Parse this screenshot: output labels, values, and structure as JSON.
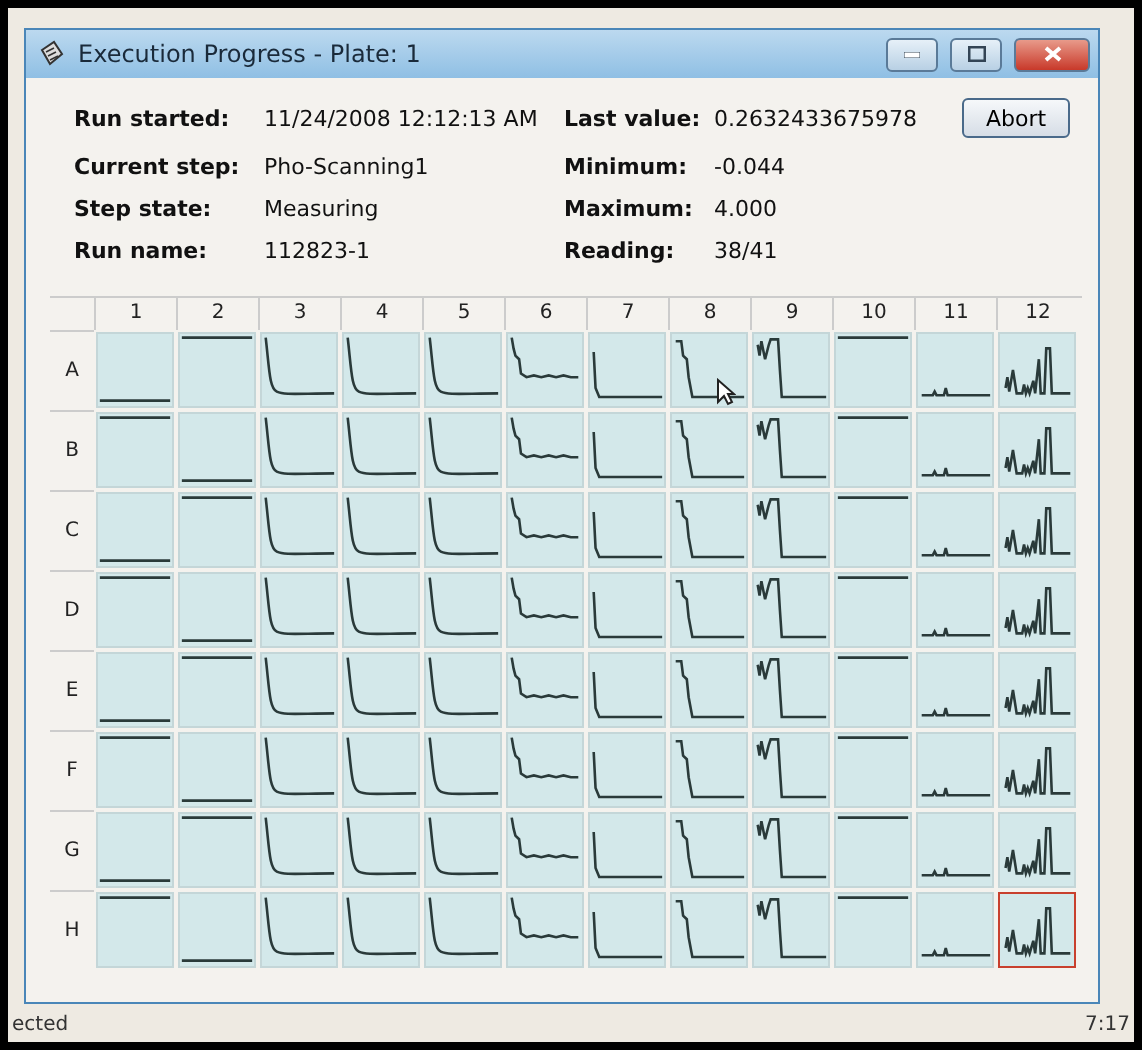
{
  "window": {
    "title": "Execution Progress - Plate: 1"
  },
  "info_left": [
    {
      "label": "Run started:",
      "value": "11/24/2008 12:12:13 AM"
    },
    {
      "label": "Current step:",
      "value": "Pho-Scanning1"
    },
    {
      "label": "Step state:",
      "value": "Measuring"
    },
    {
      "label": "Run name:",
      "value": "112823-1"
    }
  ],
  "info_right": [
    {
      "label": "Last value:",
      "value": "0.2632433675978"
    },
    {
      "label": "Minimum:",
      "value": "-0.044"
    },
    {
      "label": "Maximum:",
      "value": "4.000"
    },
    {
      "label": "Reading:",
      "value": "38/41"
    }
  ],
  "abort_button": "Abort",
  "plate": {
    "columns": [
      "1",
      "2",
      "3",
      "4",
      "5",
      "6",
      "7",
      "8",
      "9",
      "10",
      "11",
      "12"
    ],
    "rows": [
      {
        "label": "A",
        "wells": [
          {
            "kind": "line-bottom",
            "selected": false
          },
          {
            "kind": "line-top",
            "selected": false
          },
          {
            "kind": "decay",
            "selected": false
          },
          {
            "kind": "decay",
            "selected": false
          },
          {
            "kind": "decay",
            "selected": false
          },
          {
            "kind": "noisy",
            "selected": false
          },
          {
            "kind": "sharp",
            "selected": false
          },
          {
            "kind": "step",
            "selected": false
          },
          {
            "kind": "dip",
            "selected": false
          },
          {
            "kind": "line-top",
            "selected": false
          },
          {
            "kind": "small-peaks",
            "selected": false
          },
          {
            "kind": "peaks",
            "selected": false
          }
        ]
      },
      {
        "label": "B",
        "wells": [
          {
            "kind": "line-top",
            "selected": false
          },
          {
            "kind": "line-bottom",
            "selected": false
          },
          {
            "kind": "decay",
            "selected": false
          },
          {
            "kind": "decay",
            "selected": false
          },
          {
            "kind": "decay",
            "selected": false
          },
          {
            "kind": "noisy",
            "selected": false
          },
          {
            "kind": "sharp",
            "selected": false
          },
          {
            "kind": "step",
            "selected": false
          },
          {
            "kind": "dip",
            "selected": false
          },
          {
            "kind": "line-top",
            "selected": false
          },
          {
            "kind": "small-peaks",
            "selected": false
          },
          {
            "kind": "peaks",
            "selected": false
          }
        ]
      },
      {
        "label": "C",
        "wells": [
          {
            "kind": "line-bottom",
            "selected": false
          },
          {
            "kind": "line-top",
            "selected": false
          },
          {
            "kind": "decay",
            "selected": false
          },
          {
            "kind": "decay",
            "selected": false
          },
          {
            "kind": "decay",
            "selected": false
          },
          {
            "kind": "noisy",
            "selected": false
          },
          {
            "kind": "sharp",
            "selected": false
          },
          {
            "kind": "step",
            "selected": false
          },
          {
            "kind": "dip",
            "selected": false
          },
          {
            "kind": "line-top",
            "selected": false
          },
          {
            "kind": "small-peaks",
            "selected": false
          },
          {
            "kind": "peaks",
            "selected": false
          }
        ]
      },
      {
        "label": "D",
        "wells": [
          {
            "kind": "line-top",
            "selected": false
          },
          {
            "kind": "line-bottom",
            "selected": false
          },
          {
            "kind": "decay",
            "selected": false
          },
          {
            "kind": "decay",
            "selected": false
          },
          {
            "kind": "decay",
            "selected": false
          },
          {
            "kind": "noisy",
            "selected": false
          },
          {
            "kind": "sharp",
            "selected": false
          },
          {
            "kind": "step",
            "selected": false
          },
          {
            "kind": "dip",
            "selected": false
          },
          {
            "kind": "line-top",
            "selected": false
          },
          {
            "kind": "small-peaks",
            "selected": false
          },
          {
            "kind": "peaks",
            "selected": false
          }
        ]
      },
      {
        "label": "E",
        "wells": [
          {
            "kind": "line-bottom",
            "selected": false
          },
          {
            "kind": "line-top",
            "selected": false
          },
          {
            "kind": "decay",
            "selected": false
          },
          {
            "kind": "decay",
            "selected": false
          },
          {
            "kind": "decay",
            "selected": false
          },
          {
            "kind": "noisy",
            "selected": false
          },
          {
            "kind": "sharp",
            "selected": false
          },
          {
            "kind": "step",
            "selected": false
          },
          {
            "kind": "dip",
            "selected": false
          },
          {
            "kind": "line-top",
            "selected": false
          },
          {
            "kind": "small-peaks",
            "selected": false
          },
          {
            "kind": "peaks",
            "selected": false
          }
        ]
      },
      {
        "label": "F",
        "wells": [
          {
            "kind": "line-top",
            "selected": false
          },
          {
            "kind": "line-bottom",
            "selected": false
          },
          {
            "kind": "decay",
            "selected": false
          },
          {
            "kind": "decay",
            "selected": false
          },
          {
            "kind": "decay",
            "selected": false
          },
          {
            "kind": "noisy",
            "selected": false
          },
          {
            "kind": "sharp",
            "selected": false
          },
          {
            "kind": "step",
            "selected": false
          },
          {
            "kind": "dip",
            "selected": false
          },
          {
            "kind": "line-top",
            "selected": false
          },
          {
            "kind": "small-peaks",
            "selected": false
          },
          {
            "kind": "peaks",
            "selected": false
          }
        ]
      },
      {
        "label": "G",
        "wells": [
          {
            "kind": "line-bottom",
            "selected": false
          },
          {
            "kind": "line-top",
            "selected": false
          },
          {
            "kind": "decay",
            "selected": false
          },
          {
            "kind": "decay",
            "selected": false
          },
          {
            "kind": "decay",
            "selected": false
          },
          {
            "kind": "noisy",
            "selected": false
          },
          {
            "kind": "sharp",
            "selected": false
          },
          {
            "kind": "step",
            "selected": false
          },
          {
            "kind": "dip",
            "selected": false
          },
          {
            "kind": "line-top",
            "selected": false
          },
          {
            "kind": "small-peaks",
            "selected": false
          },
          {
            "kind": "peaks",
            "selected": false
          }
        ]
      },
      {
        "label": "H",
        "wells": [
          {
            "kind": "line-top",
            "selected": false
          },
          {
            "kind": "line-bottom",
            "selected": false
          },
          {
            "kind": "decay",
            "selected": false
          },
          {
            "kind": "decay",
            "selected": false
          },
          {
            "kind": "decay",
            "selected": false
          },
          {
            "kind": "noisy",
            "selected": false
          },
          {
            "kind": "sharp",
            "selected": false
          },
          {
            "kind": "step",
            "selected": false
          },
          {
            "kind": "dip",
            "selected": false
          },
          {
            "kind": "line-top",
            "selected": false
          },
          {
            "kind": "small-peaks",
            "selected": false
          },
          {
            "kind": "peaks",
            "selected": true
          }
        ]
      }
    ]
  },
  "background_texts": [
    "ected",
    "7:17"
  ]
}
